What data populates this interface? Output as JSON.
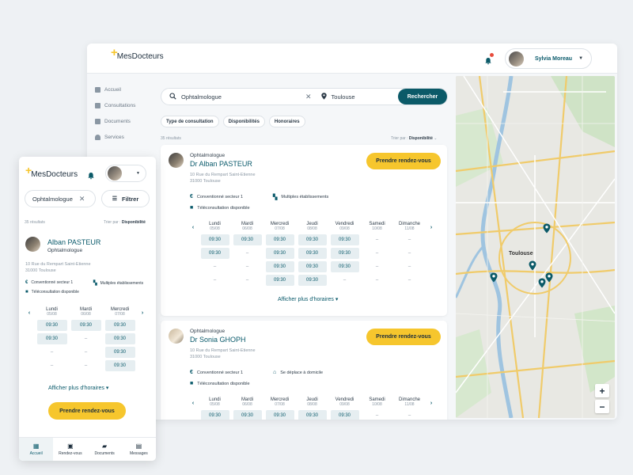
{
  "app": {
    "logo_prefix": "+",
    "logo_text": "MesDocteurs"
  },
  "user": {
    "name": "Sylvia Moreau"
  },
  "sidebar": {
    "items": [
      {
        "label": "Accueil",
        "icon": "grid-icon"
      },
      {
        "label": "Consultations",
        "icon": "calendar-icon"
      },
      {
        "label": "Documents",
        "icon": "folder-icon"
      },
      {
        "label": "Services",
        "icon": "person-icon"
      }
    ]
  },
  "search": {
    "query": "Ophtalmologue",
    "location": "Toulouse",
    "button": "Rechercher"
  },
  "filters": [
    "Type de consultation",
    "Disponibilités",
    "Honoraires"
  ],
  "results": {
    "count": "35 résultats",
    "sort_prefix": "Trier par : ",
    "sort_value": "Disponibilité"
  },
  "days": [
    {
      "name": "Lundi",
      "date": "05/08"
    },
    {
      "name": "Mardi",
      "date": "06/08"
    },
    {
      "name": "Mercredi",
      "date": "07/08"
    },
    {
      "name": "Jeudi",
      "date": "08/08"
    },
    {
      "name": "Vendredi",
      "date": "09/08"
    },
    {
      "name": "Samedi",
      "date": "10/08"
    },
    {
      "name": "Dimanche",
      "date": "11/08"
    }
  ],
  "doctors": [
    {
      "specialty": "Ophtalmologue",
      "name": "Dr Alban PASTEUR",
      "address1": "10 Rue du Rempart Saint-Etienne",
      "address2": "31000 Toulouse",
      "features": [
        "Conventionné secteur 1",
        "Multiples établissements",
        "Téléconsultation disponible"
      ],
      "cta": "Prendre rendez-vous",
      "more": "Afficher plus d'horaires",
      "slots": [
        [
          "09:30",
          "09:30",
          "–",
          "–"
        ],
        [
          "09:30",
          "–",
          "–",
          "–"
        ],
        [
          "09:30",
          "09:30",
          "09:30",
          "09:30"
        ],
        [
          "09:30",
          "09:30",
          "09:30",
          "09:30"
        ],
        [
          "09:30",
          "09:30",
          "09:30",
          "–"
        ],
        [
          "–",
          "–",
          "–",
          "–"
        ],
        [
          "–",
          "–",
          "–",
          "–"
        ]
      ]
    },
    {
      "specialty": "Ophtalmologue",
      "name": "Dr Sonia GHOPH",
      "address1": "10 Rue du Rempart Saint-Etienne",
      "address2": "31000 Toulouse",
      "features": [
        "Conventionné secteur 1",
        "Se déplace à domicile",
        "Téléconsultation disponible"
      ],
      "cta": "Prendre rendez-vous",
      "slots": [
        [
          "09:30"
        ],
        [
          "09:30"
        ],
        [
          "09:30"
        ],
        [
          "09:30"
        ],
        [
          "09:30"
        ],
        [
          "–"
        ],
        [
          "–"
        ]
      ]
    }
  ],
  "map": {
    "city": "Toulouse",
    "zoom_in": "+",
    "zoom_out": "−"
  },
  "mobile": {
    "search_query": "Ophtalmologue",
    "filter_label": "Filtrer",
    "count": "35 résultats",
    "sort_prefix": "Trier par : ",
    "sort_value": "Disponibilité",
    "doctor": {
      "name": "Alban PASTEUR",
      "specialty": "Ophtalmologue",
      "address1": "10 Rue du Rempart Saint-Etienne",
      "address2": "31000 Toulouse",
      "features": [
        "Conventionné secteur 1",
        "Multiples établissements",
        "Téléconsultation disponible"
      ]
    },
    "days": [
      {
        "name": "Lundi",
        "date": "05/08",
        "slots": [
          "09:30",
          "09:30",
          "–",
          "–"
        ]
      },
      {
        "name": "Mardi",
        "date": "06/08",
        "slots": [
          "09:30",
          "–",
          "–",
          "–"
        ]
      },
      {
        "name": "Mercredi",
        "date": "07/08",
        "slots": [
          "09:30",
          "09:30",
          "09:30",
          "09:30"
        ]
      }
    ],
    "more": "Afficher plus d'horaires",
    "cta": "Prendre rendez-vous",
    "tabs": [
      {
        "label": "Accueil",
        "icon": "grid-icon"
      },
      {
        "label": "Rendez-vous",
        "icon": "calendar-icon"
      },
      {
        "label": "Documents",
        "icon": "folder-plus-icon"
      },
      {
        "label": "Messages",
        "icon": "message-icon"
      }
    ]
  },
  "colors": {
    "primary": "#0b5a68",
    "accent": "#f6c62d",
    "notification": "#e74c3c"
  }
}
